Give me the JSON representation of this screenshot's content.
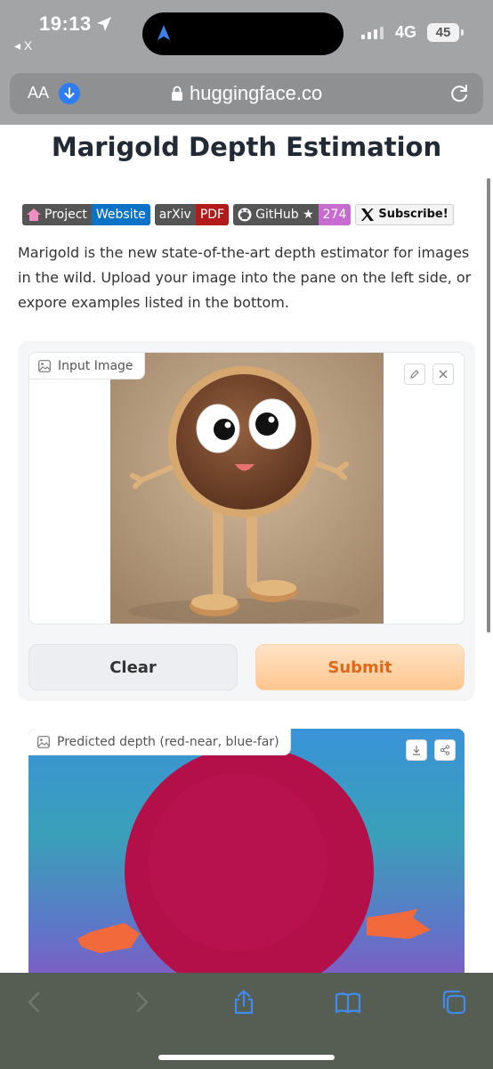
{
  "status_bar": {
    "time": "19:13",
    "back_app": "◂ X",
    "network": "4G",
    "battery": "45"
  },
  "url_bar": {
    "aa_label": "AA",
    "domain": "huggingface.co"
  },
  "page": {
    "title": "Marigold Depth Estimation",
    "badges": {
      "project_left": "Project",
      "project_right": "Website",
      "arxiv_left": "arXiv",
      "arxiv_right": "PDF",
      "github_left": "GitHub ★",
      "github_right": "274",
      "x_label": "Subscribe!"
    },
    "description": "Marigold is the new state-of-the-art depth estimator for images in the wild. Upload your image into the pane on the left side, or expore examples listed in the bottom.",
    "input_label": "Input Image",
    "clear_label": "Clear",
    "submit_label": "Submit",
    "output_label": "Predicted depth (red-near, blue-far)"
  },
  "colors": {
    "accent": "#e0681a",
    "project_badge": "#0b73c6",
    "arxiv_badge": "#b31b1b",
    "github_badge": "#c86bd0"
  },
  "toolbar": {
    "icons": [
      "back-icon",
      "forward-icon",
      "share-icon",
      "bookmarks-icon",
      "tabs-icon"
    ]
  }
}
